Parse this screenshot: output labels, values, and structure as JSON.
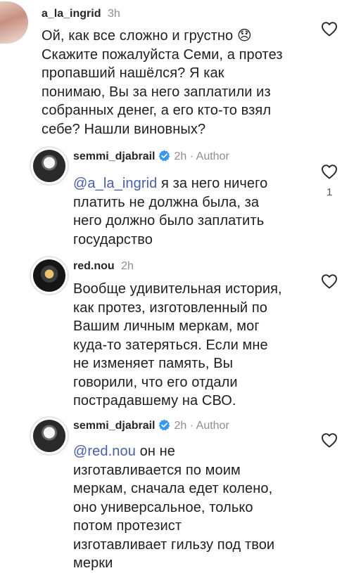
{
  "comments": [
    {
      "username": "a_la_ingrid",
      "time": "3h",
      "lines": [
        "Ой, как все сложно и грустно 😞",
        "Скажите пожалуйста Семи, а протез",
        "пропавший нашёлся? Я как",
        "понимаю, Вы за него заплатили из",
        "собранных денег, а его кто-то взял",
        "себе? Нашли виновных?"
      ]
    },
    {
      "username": "semmi_djabrail",
      "time": "2h",
      "dot": "·",
      "author": "Author",
      "mention": "@a_la_ingrid",
      "first_line_rest": " я за него ничего",
      "lines": [
        "платить не должна была, за",
        "него должно было заплатить",
        "государство"
      ],
      "like_count": "1"
    },
    {
      "username": "red.nou",
      "time": "2h",
      "lines": [
        "Вообще удивительная история,",
        "как протез, изготовленный по",
        "Вашим личным меркам, мог",
        "куда-то затеряться. Если мне",
        "не изменяет память, Вы",
        "говорили, что его отдали",
        "пострадавшему на СВО."
      ]
    },
    {
      "username": "semmi_djabrail",
      "time": "2h",
      "dot": "·",
      "author": "Author",
      "mention": "@red.nou",
      "first_line_rest": " он не",
      "lines": [
        "изготавливается по моим",
        "меркам, сначала едет колено,",
        "оно универсальное, только",
        "потом протезист",
        "изготавливает гильзу под твои",
        "мерки"
      ]
    }
  ],
  "icons": {
    "heart": "heart-outline-icon",
    "verified": "verified-badge-icon"
  },
  "colors": {
    "mention": "#4a5fa8",
    "verified": "#3897f0",
    "muted": "#8e8e8e"
  }
}
